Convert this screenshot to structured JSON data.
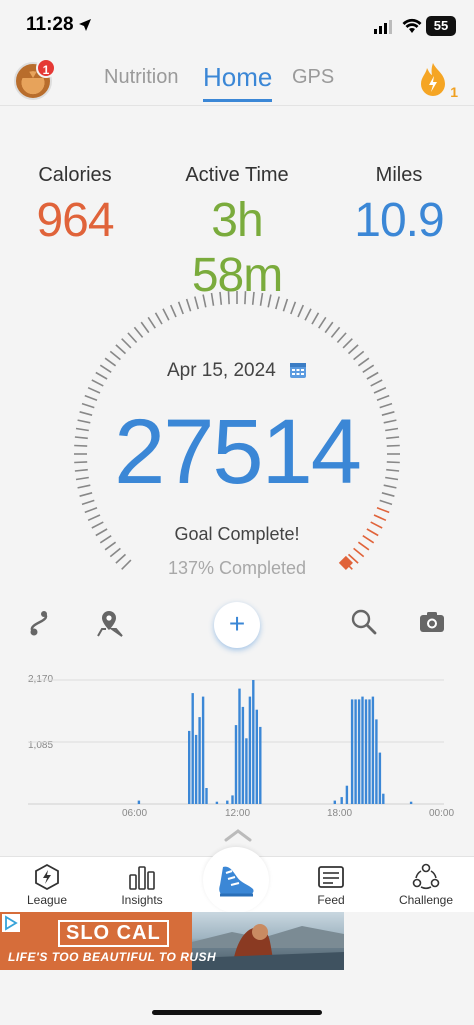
{
  "status_bar": {
    "time": "11:28",
    "battery": "55"
  },
  "top_nav": {
    "notification_count": "1",
    "tabs": [
      {
        "label": "Nutrition"
      },
      {
        "label": "Home"
      },
      {
        "label": "GPS"
      }
    ],
    "streak_count": "1"
  },
  "stats": {
    "calories": {
      "label": "Calories",
      "value": "964"
    },
    "active_time": {
      "label": "Active Time",
      "value": "3h 58m"
    },
    "miles": {
      "label": "Miles",
      "value": "10.9"
    }
  },
  "gauge": {
    "date": "Apr 15, 2024",
    "steps": "27514",
    "goal_status": "Goal Complete!",
    "percent_text": "137% Completed",
    "progress_fraction": 1.37
  },
  "toolbar": {
    "add_symbol": "+"
  },
  "chart_data": {
    "type": "bar",
    "y_tick_labels": [
      "2,170",
      "1,085"
    ],
    "x_tick_labels": [
      "06:00",
      "12:00",
      "18:00",
      "00:00"
    ],
    "ylim": [
      0,
      2170
    ],
    "xlim_hours": [
      0,
      24
    ],
    "bars": [
      {
        "h": 6.4,
        "v": 60
      },
      {
        "h": 9.3,
        "v": 1280
      },
      {
        "h": 9.5,
        "v": 1940
      },
      {
        "h": 9.7,
        "v": 1210
      },
      {
        "h": 9.9,
        "v": 1520
      },
      {
        "h": 10.1,
        "v": 1880
      },
      {
        "h": 10.3,
        "v": 280
      },
      {
        "h": 10.9,
        "v": 40
      },
      {
        "h": 11.5,
        "v": 60
      },
      {
        "h": 11.8,
        "v": 150
      },
      {
        "h": 12.0,
        "v": 1380
      },
      {
        "h": 12.2,
        "v": 2020
      },
      {
        "h": 12.4,
        "v": 1700
      },
      {
        "h": 12.6,
        "v": 1150
      },
      {
        "h": 12.8,
        "v": 1880
      },
      {
        "h": 13.0,
        "v": 2170
      },
      {
        "h": 13.2,
        "v": 1650
      },
      {
        "h": 13.4,
        "v": 1350
      },
      {
        "h": 17.7,
        "v": 60
      },
      {
        "h": 18.1,
        "v": 120
      },
      {
        "h": 18.4,
        "v": 320
      },
      {
        "h": 18.7,
        "v": 1830
      },
      {
        "h": 18.9,
        "v": 1830
      },
      {
        "h": 19.1,
        "v": 1830
      },
      {
        "h": 19.3,
        "v": 1880
      },
      {
        "h": 19.5,
        "v": 1830
      },
      {
        "h": 19.7,
        "v": 1830
      },
      {
        "h": 19.9,
        "v": 1880
      },
      {
        "h": 20.1,
        "v": 1480
      },
      {
        "h": 20.3,
        "v": 900
      },
      {
        "h": 20.5,
        "v": 180
      },
      {
        "h": 22.1,
        "v": 40
      }
    ],
    "color": "#3b87d6",
    "grid": true
  },
  "bottom_nav": {
    "items": [
      {
        "label": "League"
      },
      {
        "label": "Insights"
      },
      {
        "label": "Feed"
      },
      {
        "label": "Challenge"
      }
    ]
  },
  "ad": {
    "brand": "SLO CAL",
    "tagline": "LIFE'S TOO BEAUTIFUL TO RUSH"
  },
  "colors": {
    "accent": "#3b87d6",
    "calories": "#e0633a",
    "active": "#7aab3c",
    "miles": "#3b87d6",
    "gauge_end": "#e0633a"
  }
}
